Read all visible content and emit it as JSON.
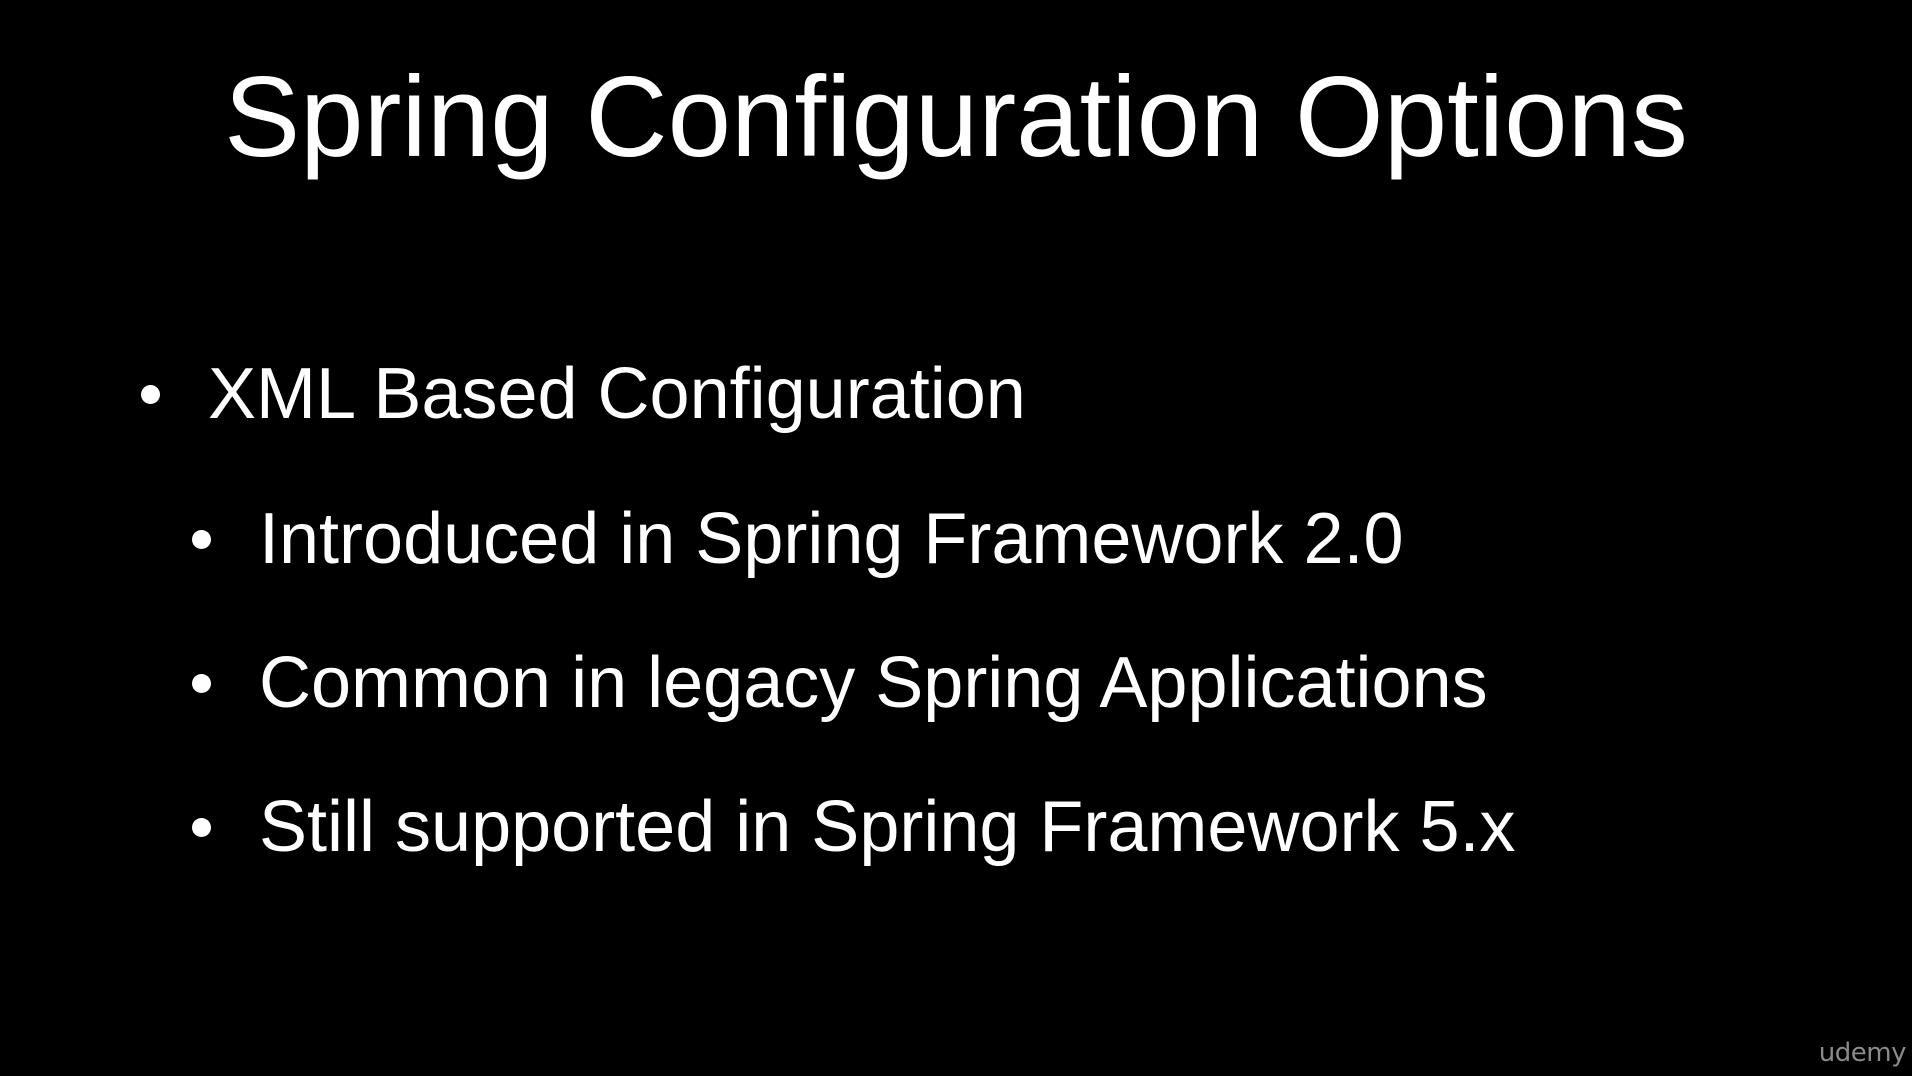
{
  "slide": {
    "title": "Spring Configuration Options",
    "bullets": [
      {
        "text": "XML Based Configuration",
        "level": 1
      },
      {
        "text": "Introduced in Spring Framework 2.0",
        "level": 2
      },
      {
        "text": "Common in legacy Spring Applications",
        "level": 2
      },
      {
        "text": "Still supported in Spring Framework 5.x",
        "level": 2
      }
    ],
    "watermark": "udemy"
  },
  "colors": {
    "background": "#000000",
    "text": "#ffffff",
    "watermark": "#8a8a8a"
  }
}
